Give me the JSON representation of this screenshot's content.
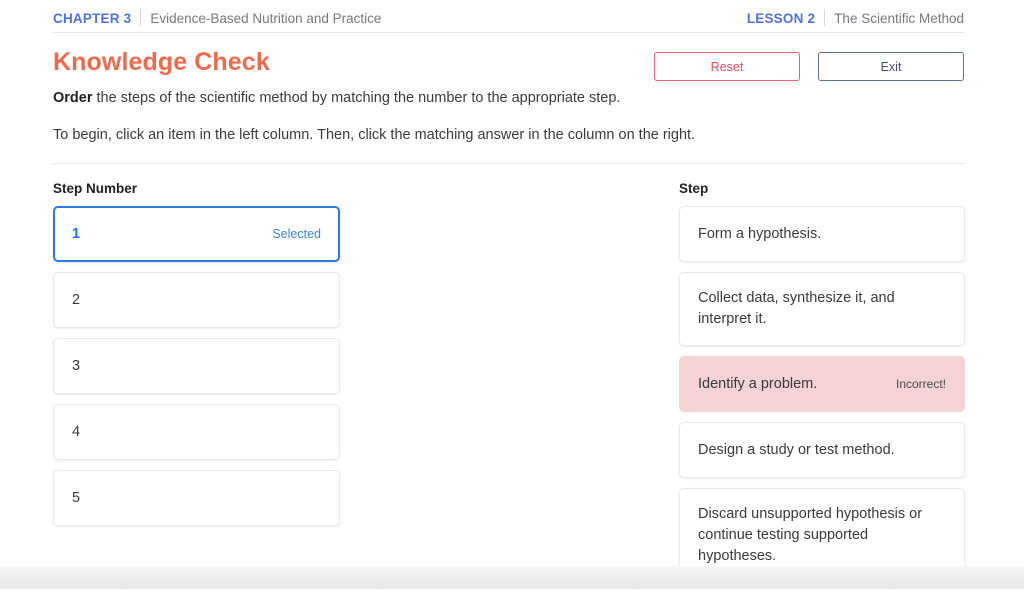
{
  "header": {
    "chapter_label": "CHAPTER 3",
    "chapter_title": "Evidence-Based Nutrition and Practice",
    "lesson_label": "LESSON 2",
    "lesson_title": "The Scientific Method"
  },
  "title": {
    "text": "Knowledge Check",
    "color": "#ef6a4c"
  },
  "buttons": {
    "reset_label": "Reset",
    "exit_label": "Exit",
    "reset_color": "#e84a5c",
    "exit_color": "#45526b"
  },
  "instructions": {
    "line1_bold": "Order",
    "line1_rest": " the steps of the scientific method by matching the number to the appropriate step.",
    "line2": "To begin, click an item in the left column. Then, click the matching answer in the column on the right."
  },
  "left_column": {
    "heading": "Step Number",
    "items": [
      {
        "label": "1",
        "state": "selected",
        "tag": "Selected"
      },
      {
        "label": "2",
        "state": "default",
        "tag": ""
      },
      {
        "label": "3",
        "state": "default",
        "tag": ""
      },
      {
        "label": "4",
        "state": "default",
        "tag": ""
      },
      {
        "label": "5",
        "state": "default",
        "tag": ""
      }
    ]
  },
  "right_column": {
    "heading": "Step",
    "items": [
      {
        "label": "Form a hypothesis.",
        "state": "default",
        "tag": ""
      },
      {
        "label": "Collect data, synthesize it, and interpret it.",
        "state": "default",
        "tag": ""
      },
      {
        "label": "Identify a problem.",
        "state": "incorrect",
        "tag": "Incorrect!"
      },
      {
        "label": "Design a study or test method.",
        "state": "default",
        "tag": ""
      },
      {
        "label": "Discard unsupported hypothesis or continue testing supported hypotheses.",
        "state": "default",
        "tag": ""
      }
    ]
  },
  "colors": {
    "accent_blue": "#4f73d6",
    "selected_blue": "#2a7ae2",
    "incorrect_pink": "#f4d2d6",
    "title_orange": "#ef6a4c"
  }
}
